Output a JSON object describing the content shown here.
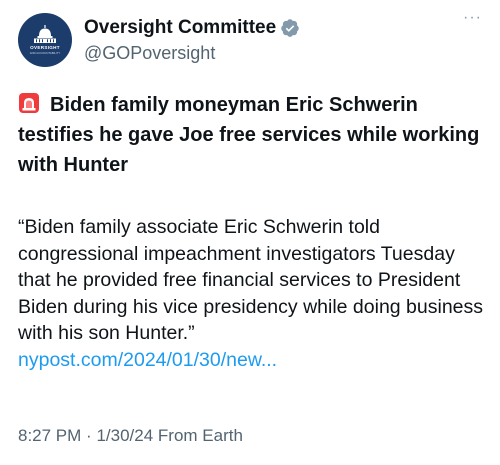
{
  "account": {
    "display_name": "Oversight Committee",
    "handle": "@GOPoversight",
    "avatar_seal_text": "OVERSIGHT",
    "avatar_seal_subtext": "AND ACCOUNTABILITY",
    "verified_color": "#829aab"
  },
  "more_menu": {
    "icon": "more-horizontal-icon",
    "label": "···"
  },
  "tweet": {
    "headline_icon": "rotating-light-siren-icon",
    "headline": "Biden family moneyman Eric Schwerin testifies he gave Joe free services while working with Hunter",
    "quote": "“Biden family associate Eric Schwerin told congressional impeachment investigators Tuesday that he provided free financial services to President Biden during his vice presidency while doing business with his son Hunter.”",
    "link_text": "nypost.com/2024/01/30/new...",
    "time": "8:27 PM",
    "date": "1/30/24",
    "source": "From Earth",
    "separator": "·"
  },
  "colors": {
    "text": "#0f1419",
    "secondary": "#536471",
    "link": "#1d9bf0",
    "avatar_bg": "#1c3c6b"
  }
}
